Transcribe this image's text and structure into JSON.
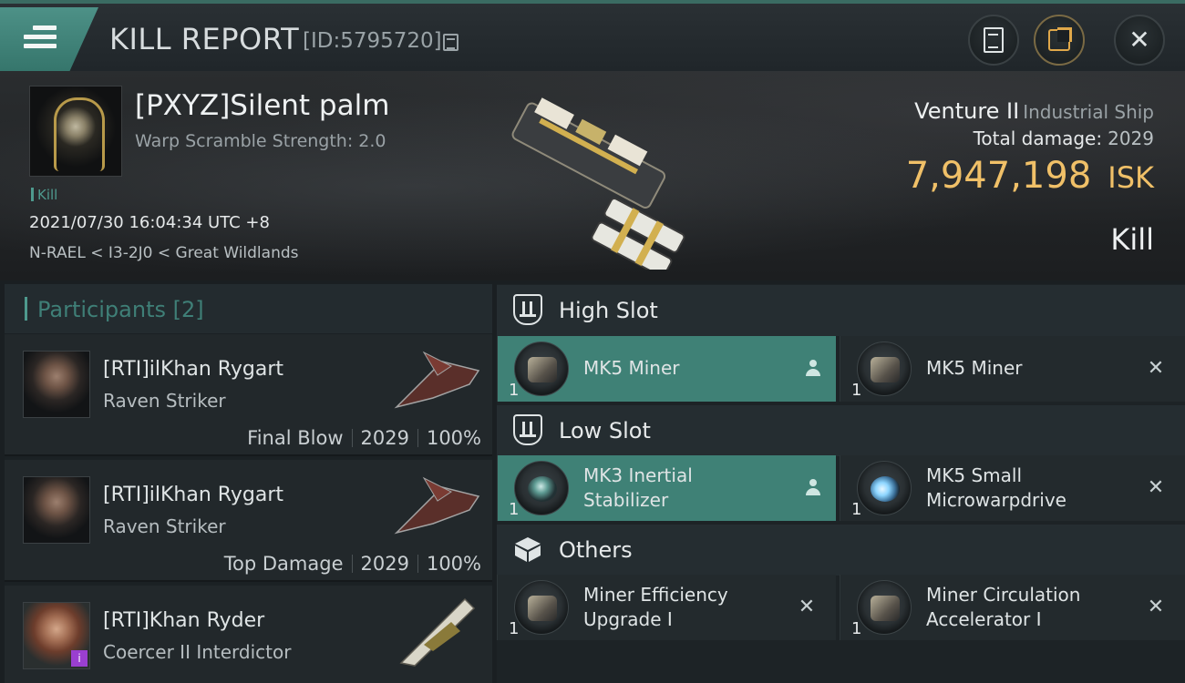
{
  "header": {
    "title": "KILL REPORT",
    "report_id": "[ID:5795720]",
    "buttons": {
      "report": "report-icon",
      "share": "share-icon",
      "close": "close-icon"
    }
  },
  "summary": {
    "victim_name": "[PXYZ]Silent palm",
    "warp_scramble": "Warp Scramble Strength: 2.0",
    "kill_tag": "Kill",
    "datetime": "2021/07/30 16:04:34 UTC +8",
    "location": "N-RAEL < I3-2J0 < Great Wildlands",
    "ship_name": "Venture II",
    "ship_class": "Industrial Ship",
    "total_damage_label": "Total damage:",
    "total_damage": "2029",
    "isk_value": "7,947,198",
    "isk_unit": "ISK",
    "result": "Kill"
  },
  "participants": {
    "title": "Participants",
    "count": "[2]",
    "items": [
      {
        "name": "[RTI]ilKhan Rygart",
        "ship": "Raven Striker",
        "role": "Final Blow",
        "damage": "2029",
        "percent": "100%"
      },
      {
        "name": "[RTI]ilKhan Rygart",
        "ship": "Raven Striker",
        "role": "Top Damage",
        "damage": "2029",
        "percent": "100%"
      },
      {
        "name": "[RTI]Khan Ryder",
        "ship": "Coercer II Interdictor",
        "role": "",
        "damage": "",
        "percent": ""
      }
    ]
  },
  "fitting": {
    "high_slot": {
      "label": "High Slot",
      "modules": [
        {
          "name": "MK5 Miner",
          "qty": "1",
          "status": "dropped"
        },
        {
          "name": "MK5 Miner",
          "qty": "1",
          "status": "destroyed"
        }
      ]
    },
    "low_slot": {
      "label": "Low Slot",
      "modules": [
        {
          "name_line1": "MK3 Inertial",
          "name_line2": "Stabilizer",
          "qty": "1",
          "status": "dropped"
        },
        {
          "name_line1": "MK5 Small",
          "name_line2": "Microwarpdrive",
          "qty": "1",
          "status": "destroyed"
        }
      ]
    },
    "others": {
      "label": "Others",
      "modules": [
        {
          "name_line1": "Miner Efficiency",
          "name_line2": "Upgrade I",
          "qty": "1",
          "status": "destroyed"
        },
        {
          "name_line1": "Miner Circulation",
          "name_line2": "Accelerator I",
          "qty": "1",
          "status": "destroyed"
        }
      ]
    },
    "icons": {
      "destroyed": "✕",
      "dropped": "person-icon"
    }
  },
  "colors": {
    "accent": "#3f8176",
    "isk": "#f0c068",
    "teal_text": "#3f7f77"
  }
}
